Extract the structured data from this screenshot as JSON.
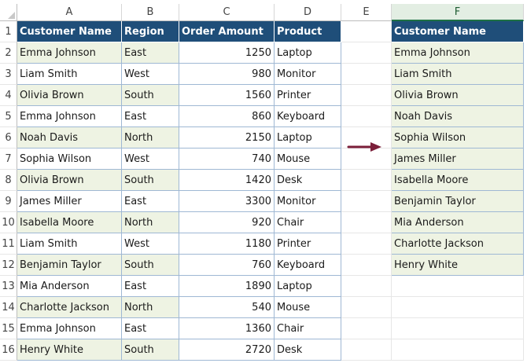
{
  "columns": [
    "A",
    "B",
    "C",
    "D",
    "E",
    "F"
  ],
  "rows": [
    "1",
    "2",
    "3",
    "4",
    "5",
    "6",
    "7",
    "8",
    "9",
    "10",
    "11",
    "12",
    "13",
    "14",
    "15",
    "16"
  ],
  "headers": {
    "customer_name": "Customer Name",
    "region": "Region",
    "order_amount": "Order Amount",
    "product": "Product",
    "unique_customer_name": "Customer Name"
  },
  "table": [
    {
      "name": "Emma Johnson",
      "region": "East",
      "amount": "1250",
      "product": "Laptop"
    },
    {
      "name": "Liam Smith",
      "region": "West",
      "amount": "980",
      "product": "Monitor"
    },
    {
      "name": "Olivia Brown",
      "region": "South",
      "amount": "1560",
      "product": "Printer"
    },
    {
      "name": "Emma Johnson",
      "region": "East",
      "amount": "860",
      "product": "Keyboard"
    },
    {
      "name": "Noah Davis",
      "region": "North",
      "amount": "2150",
      "product": "Laptop"
    },
    {
      "name": "Sophia Wilson",
      "region": "West",
      "amount": "740",
      "product": "Mouse"
    },
    {
      "name": "Olivia Brown",
      "region": "South",
      "amount": "1420",
      "product": "Desk"
    },
    {
      "name": "James Miller",
      "region": "East",
      "amount": "3300",
      "product": "Monitor"
    },
    {
      "name": "Isabella Moore",
      "region": "North",
      "amount": "920",
      "product": "Chair"
    },
    {
      "name": "Liam Smith",
      "region": "West",
      "amount": "1180",
      "product": "Printer"
    },
    {
      "name": "Benjamin Taylor",
      "region": "South",
      "amount": "760",
      "product": "Keyboard"
    },
    {
      "name": "Mia Anderson",
      "region": "East",
      "amount": "1890",
      "product": "Laptop"
    },
    {
      "name": "Charlotte Jackson",
      "region": "North",
      "amount": "540",
      "product": "Mouse"
    },
    {
      "name": "Emma Johnson",
      "region": "East",
      "amount": "1360",
      "product": "Chair"
    },
    {
      "name": "Henry White",
      "region": "South",
      "amount": "2720",
      "product": "Desk"
    }
  ],
  "unique_list": [
    "Emma Johnson",
    "Liam Smith",
    "Olivia Brown",
    "Noah Davis",
    "Sophia Wilson",
    "James Miller",
    "Isabella Moore",
    "Benjamin Taylor",
    "Mia Anderson",
    "Charlotte Jackson",
    "Henry White"
  ],
  "colors": {
    "header_fill": "#1f4e79",
    "band_fill": "#eef3e3",
    "arrow": "#7b1f3a",
    "selected_column": "#e3eee3"
  },
  "icons": {
    "arrow": "right-arrow-icon"
  }
}
